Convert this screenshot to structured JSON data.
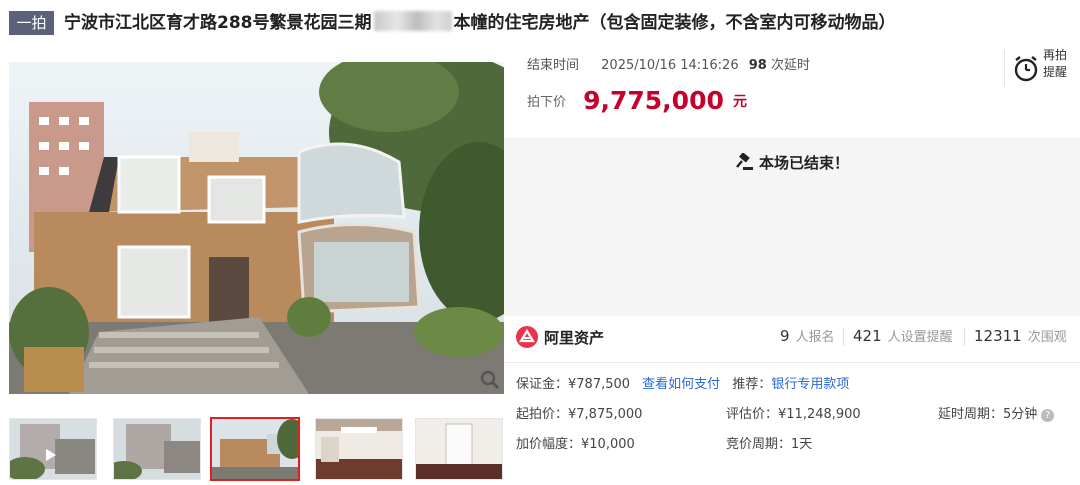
{
  "header": {
    "badge": "一拍",
    "title_before": "宁波市江北区育才路288号繁景花园三期",
    "title_after": "本幢的住宅房地产（包含固定装修，不含室内可移动物品）"
  },
  "auction": {
    "end_label": "结束时间",
    "end_time": "2025/10/16 14:16:26",
    "delay_count": "98",
    "delay_label": "次延时",
    "price_label": "拍下价",
    "price": "9,775,000",
    "price_unit": "元",
    "remind_label": "再拍提醒",
    "status_text": "本场已结束！"
  },
  "stats": {
    "brand": "阿里资产",
    "signups": "9",
    "signups_label": "人报名",
    "reminders": "421",
    "reminders_label": "人设置提醒",
    "views": "12311",
    "views_label": "次围观"
  },
  "details": {
    "deposit": "保证金：¥787,500",
    "pay_link": "查看如何支付",
    "recommend_label": "推荐：",
    "recommend_link": "银行专用款项",
    "start_price": "起拍价：¥7,875,000",
    "appraisal": "评估价：¥11,248,900",
    "delay_period": "延时周期：5分钟",
    "increment": "加价幅度：¥10,000",
    "bid_period": "竞价周期：1天"
  },
  "gallery": {
    "thumbnail_count": 5,
    "active_index": 2
  },
  "colors": {
    "price": "#c7002b",
    "badge": "#5a6178",
    "link": "#2a6ad4",
    "active_thumb_border": "#e02020"
  },
  "icons": [
    "zoom-icon",
    "alarm-clock-icon",
    "gavel-icon",
    "alibaba-asset-logo",
    "help-icon"
  ]
}
